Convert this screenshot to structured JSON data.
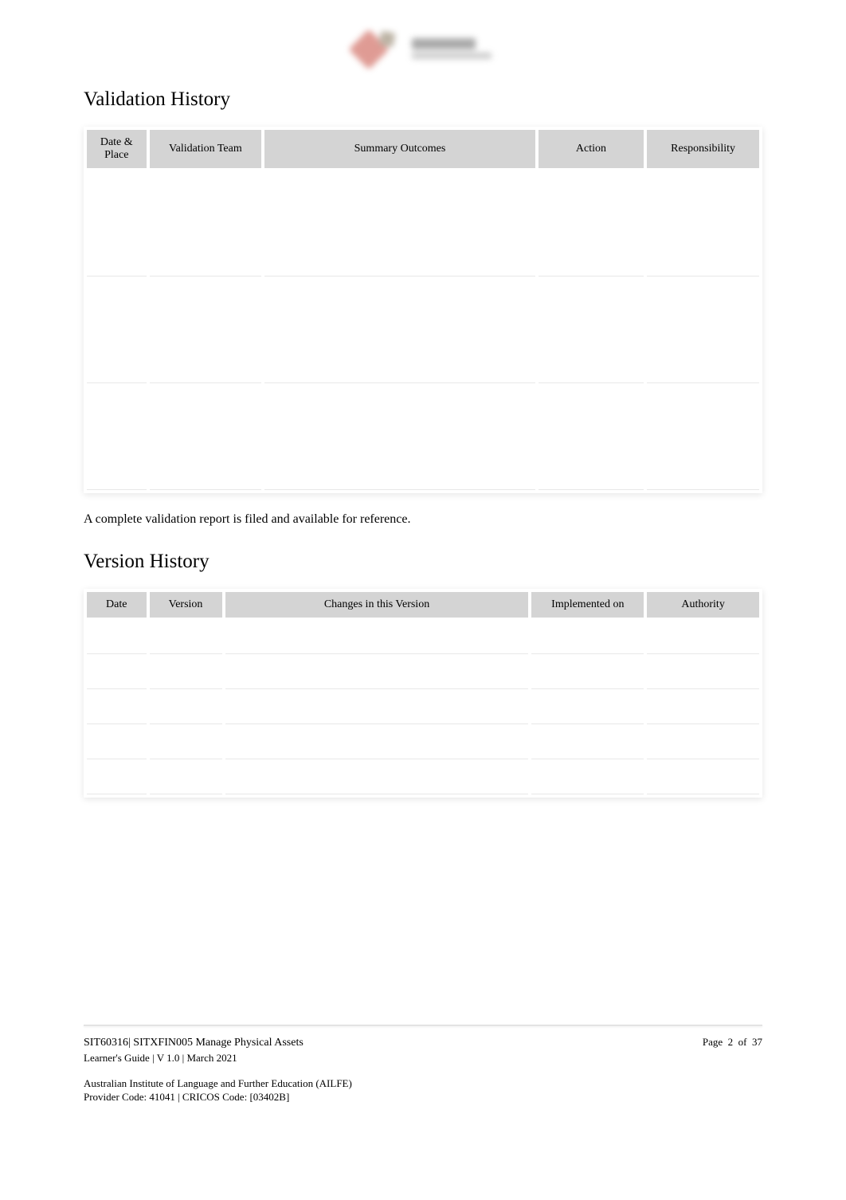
{
  "sections": {
    "validation_heading": "Validation History",
    "version_heading": "Version History"
  },
  "validation_table": {
    "headers": [
      "Date & Place",
      "Validation Team",
      "Summary Outcomes",
      "Action",
      "Responsibility"
    ],
    "rows": [
      [
        "",
        "",
        "",
        "",
        ""
      ],
      [
        "",
        "",
        "",
        "",
        ""
      ],
      [
        "",
        "",
        "",
        "",
        ""
      ]
    ]
  },
  "validation_note": "A complete validation report is filed and available for reference.",
  "version_table": {
    "headers": [
      "Date",
      "Version",
      "Changes in this Version",
      "Implemented on",
      "Authority"
    ],
    "rows": [
      [
        "",
        "",
        "",
        "",
        ""
      ],
      [
        "",
        "",
        "",
        "",
        ""
      ],
      [
        "",
        "",
        "",
        "",
        ""
      ],
      [
        "",
        "",
        "",
        "",
        ""
      ],
      [
        "",
        "",
        "",
        "",
        ""
      ]
    ]
  },
  "footer": {
    "doc_id": "SIT60316| SITXFIN005 Manage Physical Assets",
    "guide_line": "Learner's Guide | V 1.0 | March 2021",
    "institute": "Australian Institute of Language and Further Education (AILFE)",
    "provider": "Provider Code: 41041 | CRICOS Code: [03402B]",
    "page_label_prefix": "Page",
    "page_current": "2",
    "page_of": "of",
    "page_total": "37"
  }
}
